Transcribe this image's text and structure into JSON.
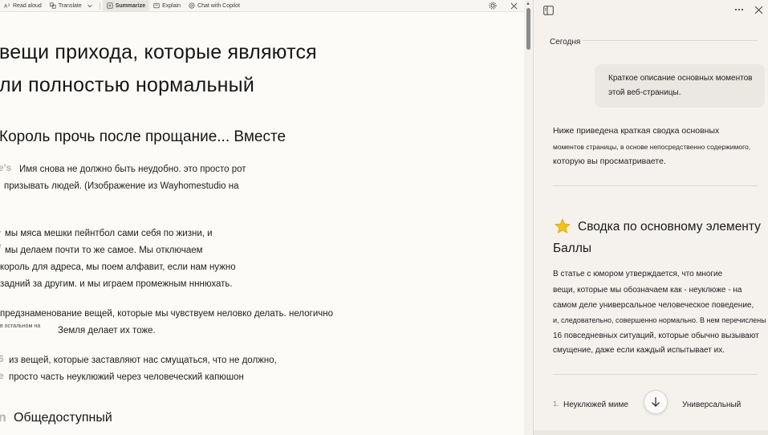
{
  "toolbar": {
    "read_aloud": "Read aloud",
    "translate": "Translate",
    "summarize": "Summarize",
    "explain": "Explain",
    "chat": "Chat with Copilot"
  },
  "article": {
    "title_line1": "вещи прихода, которые являются",
    "title_line2": "ли полностью нормальный",
    "subtitle": "Король прочь после прощание... Вместе",
    "p1_cap": "e's",
    "p1_l1": "Имя снова не должно быть неудобно. это просто рот",
    "p1_l2": "призывать людей. (Изображение из Wayhomestudio на",
    "p2_l1": "мы мяса мешки пейнтбол сами себя по жизни, и",
    "p2_l2": "мы делаем почти то же самое. Мы отключаем",
    "p2_l3": "король для адреса, мы поем алфавит, если нам нужно",
    "p2_l4": "задний за другим. и мы играем промежным нннюхать.",
    "p3_l1": "предзнаменование вещей, которые мы чувствуем неловко делать. нелогично",
    "p3_small": "в остальном на",
    "p3_l2": "Земля делает их тоже.",
    "p4_cap": "6",
    "p4_l1": "из вещей, которые заставляют нас смущаться, что не должно,",
    "p4_cap2": "е",
    "p4_l2": "просто часть неуклюжий через человеческий капюшон",
    "section_cap": "n",
    "section": "Общедоступный"
  },
  "copilot": {
    "today": "Сегодня",
    "user_msg_l1": "Краткое описание основных моментов",
    "user_msg_l2": "этой веб-страницы.",
    "answer_l1": "Ниже приведена краткая сводка основных",
    "answer_l2": "моментов страницы, в основе непосредственно содержимого,",
    "answer_l3": "которую вы просматриваете.",
    "card_title_l1": "Сводка по основному элементу",
    "card_title_l2": "Баллы",
    "card_l1": "В статье с юмором утверждается, что многие",
    "card_l2": "вещи, которые мы обозначаем как - неуклюже - на",
    "card_l3": "самом деле универсальное человеческое поведение,",
    "card_l4": "и, следовательно, совершенно нормально. В нем перечислены",
    "card_l5": "16 повседневных ситуаций, которые обычно вызывают",
    "card_l6": "смущение, даже если каждый испытывает их.",
    "list_num": "1.",
    "list_left": "Неуклюжей миме",
    "list_right": "Универсальный"
  },
  "colors": {
    "accent": "#f2c21b",
    "pane_bg": "#f5f2ee",
    "reader_bg": "#fcfbf7"
  }
}
